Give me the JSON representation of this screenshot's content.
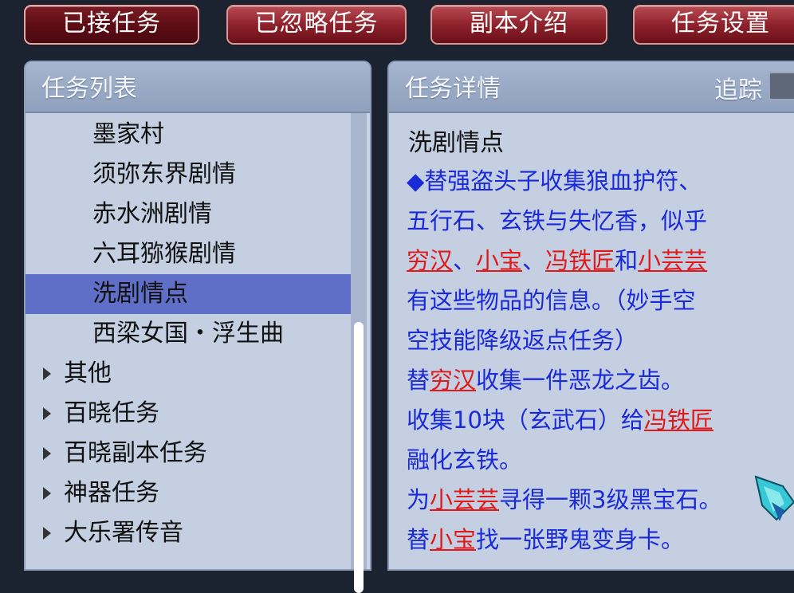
{
  "tabs": [
    {
      "label": "已接任务",
      "active": true
    },
    {
      "label": "已忽略任务",
      "active": false
    },
    {
      "label": "副本介绍",
      "active": false
    },
    {
      "label": "任务设置",
      "active": false
    }
  ],
  "list_panel": {
    "title": "任务列表",
    "items": [
      {
        "label": "墨家村",
        "kind": "sub"
      },
      {
        "label": "须弥东界剧情",
        "kind": "sub"
      },
      {
        "label": "赤水洲剧情",
        "kind": "sub"
      },
      {
        "label": "六耳猕猴剧情",
        "kind": "sub"
      },
      {
        "label": "洗剧情点",
        "kind": "sub",
        "selected": true
      },
      {
        "label": "西梁女国・浮生曲",
        "kind": "sub"
      },
      {
        "label": "其他",
        "kind": "category"
      },
      {
        "label": "百晓任务",
        "kind": "category"
      },
      {
        "label": "百晓副本任务",
        "kind": "category"
      },
      {
        "label": "神器任务",
        "kind": "category"
      },
      {
        "label": "大乐署传音",
        "kind": "category"
      }
    ]
  },
  "detail_panel": {
    "title": "任务详情",
    "track_label": "追踪",
    "quest_name": "洗剧情点",
    "lines": [
      {
        "parts": [
          {
            "t": "◆替强盗头子收集狼血护符、"
          }
        ]
      },
      {
        "parts": [
          {
            "t": "五行石、玄铁与失忆香，似乎"
          }
        ]
      },
      {
        "parts": [
          {
            "t": "穷汉",
            "hl": true
          },
          {
            "t": "、"
          },
          {
            "t": "小宝",
            "hl": true
          },
          {
            "t": "、"
          },
          {
            "t": "冯铁匠",
            "hl": true
          },
          {
            "t": "和"
          },
          {
            "t": "小芸芸",
            "hl": true
          }
        ]
      },
      {
        "parts": [
          {
            "t": "有这些物品的信息。（妙手空"
          }
        ]
      },
      {
        "parts": [
          {
            "t": "空技能降级返点任务）"
          }
        ]
      },
      {
        "parts": [
          {
            "t": "替"
          },
          {
            "t": "穷汉",
            "hl": true
          },
          {
            "t": "收集一件恶龙之齿。"
          }
        ]
      },
      {
        "parts": [
          {
            "t": "收集10块（玄武石）给"
          },
          {
            "t": "冯铁匠",
            "hl": true
          }
        ]
      },
      {
        "parts": [
          {
            "t": "融化玄铁。"
          }
        ]
      },
      {
        "parts": [
          {
            "t": "为"
          },
          {
            "t": "小芸芸",
            "hl": true
          },
          {
            "t": "寻得一颗3级黑宝石。"
          }
        ]
      },
      {
        "parts": [
          {
            "t": "替"
          },
          {
            "t": "小宝",
            "hl": true
          },
          {
            "t": "找一张野鬼变身卡。"
          }
        ]
      }
    ]
  },
  "colors": {
    "quest_text": "#1a2ad8",
    "npc_highlight": "#e0191b",
    "selected_row": "#5f6fc8",
    "tab_red": "#8e222c"
  }
}
